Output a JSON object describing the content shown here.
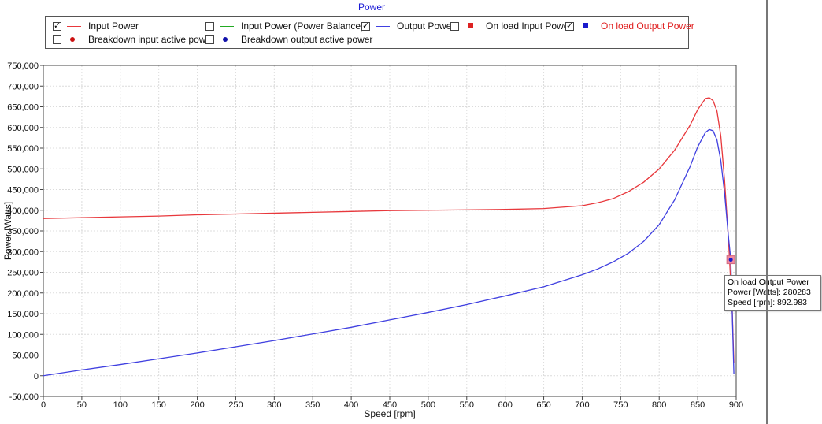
{
  "chart_data": {
    "type": "line",
    "title": "Power",
    "xlabel": "Speed [rpm]",
    "ylabel": "Power [Watts]",
    "xlim": [
      0,
      900
    ],
    "ylim": [
      -50000,
      750000
    ],
    "xticks": [
      0,
      50,
      100,
      150,
      200,
      250,
      300,
      350,
      400,
      450,
      500,
      550,
      600,
      650,
      700,
      750,
      800,
      850,
      900
    ],
    "yticks": [
      -50000,
      0,
      50000,
      100000,
      150000,
      200000,
      250000,
      300000,
      350000,
      400000,
      450000,
      500000,
      550000,
      600000,
      650000,
      700000,
      750000
    ],
    "xtick_labels": [
      "0",
      "50",
      "100",
      "150",
      "200",
      "250",
      "300",
      "350",
      "400",
      "450",
      "500",
      "550",
      "600",
      "650",
      "700",
      "750",
      "800",
      "850",
      "900"
    ],
    "ytick_labels": [
      "-50,000",
      "0",
      "50,000",
      "100,000",
      "150,000",
      "200,000",
      "250,000",
      "300,000",
      "350,000",
      "400,000",
      "450,000",
      "500,000",
      "550,000",
      "600,000",
      "650,000",
      "700,000",
      "750,000"
    ],
    "grid": true,
    "legend_position": "top",
    "series": [
      {
        "name": "Input Power",
        "color": "#e8383c",
        "visible": true,
        "x": [
          0,
          50,
          100,
          150,
          200,
          250,
          300,
          350,
          400,
          450,
          500,
          550,
          600,
          650,
          700,
          720,
          740,
          760,
          780,
          800,
          820,
          840,
          850,
          860,
          865,
          870,
          875,
          880,
          885,
          890,
          895,
          897
        ],
        "y": [
          380000,
          382000,
          384000,
          386000,
          389000,
          391000,
          393000,
          395000,
          397000,
          399000,
          400000,
          401000,
          402000,
          404000,
          411000,
          418000,
          428000,
          445000,
          468000,
          500000,
          545000,
          605000,
          643000,
          670000,
          672000,
          665000,
          640000,
          580000,
          470000,
          330000,
          150000,
          30000
        ]
      },
      {
        "name": "Input Power (Power Balance)",
        "color": "#22aa22",
        "visible": false,
        "x": [],
        "y": []
      },
      {
        "name": "Output Power",
        "color": "#4040e0",
        "visible": true,
        "x": [
          0,
          50,
          100,
          150,
          200,
          250,
          300,
          350,
          400,
          450,
          500,
          550,
          600,
          650,
          700,
          720,
          740,
          760,
          780,
          800,
          820,
          840,
          850,
          860,
          865,
          870,
          875,
          880,
          885,
          890,
          893,
          897
        ],
        "y": [
          0,
          14000,
          27000,
          41000,
          55000,
          70000,
          85000,
          101000,
          117000,
          135000,
          153000,
          172000,
          193000,
          215000,
          244000,
          258000,
          275000,
          296000,
          325000,
          365000,
          425000,
          505000,
          553000,
          588000,
          595000,
          592000,
          570000,
          520000,
          440000,
          335000,
          280283,
          5000
        ]
      },
      {
        "name": "On load Input Power",
        "color": "#dd2222",
        "visible": false,
        "x": [],
        "y": []
      },
      {
        "name": "On load Output Power",
        "color": "#1a1acc",
        "visible": true,
        "x": [
          892.983
        ],
        "y": [
          280283
        ]
      },
      {
        "name": "Breakdown input active power",
        "color": "#cc1111",
        "visible": false,
        "x": [],
        "y": []
      },
      {
        "name": "Breakdown output active power",
        "color": "#1111aa",
        "visible": false,
        "x": [],
        "y": []
      }
    ]
  },
  "legend": {
    "items": [
      {
        "label": "Input Power",
        "checked": true,
        "marker": "line",
        "color": "#e8383c",
        "text_color": "#111111"
      },
      {
        "label": "Input Power (Power Balance)",
        "checked": false,
        "marker": "line",
        "color": "#22aa22",
        "text_color": "#111111"
      },
      {
        "label": "Output Power",
        "checked": true,
        "marker": "line",
        "color": "#4040e0",
        "text_color": "#111111"
      },
      {
        "label": "On load Input Power",
        "checked": false,
        "marker": "square",
        "color": "#dd2222",
        "text_color": "#111111"
      },
      {
        "label": "On load Output Power",
        "checked": true,
        "marker": "square",
        "color": "#1a1acc",
        "text_color": "#e02020"
      },
      {
        "label": "Breakdown input active power",
        "checked": false,
        "marker": "dot",
        "color": "#cc1111",
        "text_color": "#111111"
      },
      {
        "label": "Breakdown output active power",
        "checked": false,
        "marker": "dot",
        "color": "#1111aa",
        "text_color": "#111111"
      }
    ]
  },
  "tooltip": {
    "series": "On load Output Power",
    "line1": "Power [Watts]: 280283",
    "line2": "Speed [rpm]: 892.983"
  },
  "colors": {
    "title": "#1a1ad6",
    "grid": "#dcdcdc",
    "axis": "#444444",
    "highlight": "#f08aa0"
  }
}
